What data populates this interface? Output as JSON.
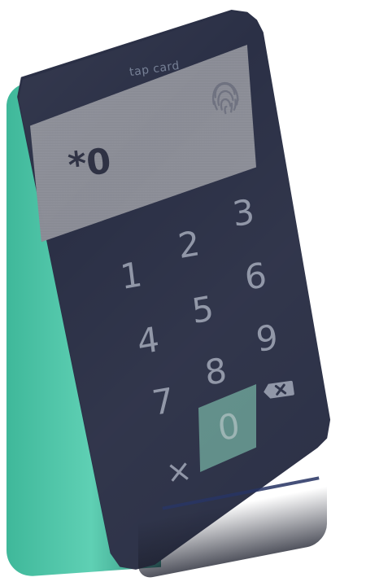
{
  "device": {
    "top_label": "tap card",
    "accent_color": "#59c3a7",
    "face_color": "#2b3046",
    "display_color": "#8b8d97"
  },
  "display": {
    "value": "*0",
    "icon": "fingerprint-icon"
  },
  "keypad": {
    "keys": [
      "1",
      "2",
      "3",
      "4",
      "5",
      "6",
      "7",
      "8",
      "9",
      "0"
    ],
    "cancel_label": "×",
    "backspace_icon": "backspace-icon",
    "selected_key": "0"
  }
}
